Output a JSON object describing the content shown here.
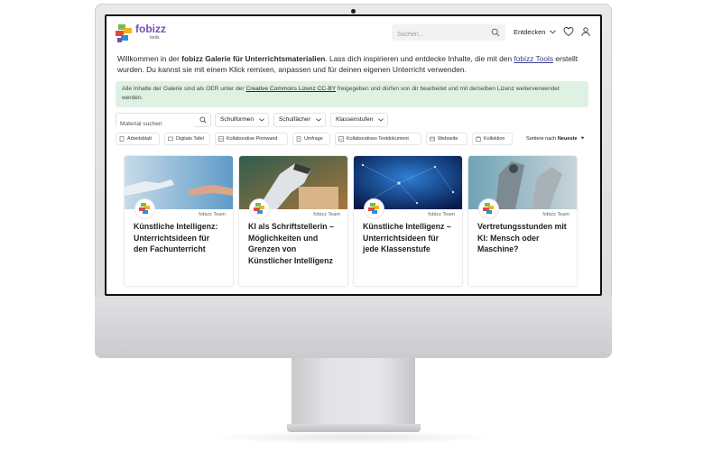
{
  "app": {
    "logo_text": "fobizz",
    "logo_sub": "tools",
    "brand_color": "#7a4fb0"
  },
  "header": {
    "search_placeholder": "Suchen...",
    "explore_label": "Entdecken",
    "icons": [
      "search-icon",
      "chevron-down-icon",
      "heart-icon",
      "user-icon"
    ]
  },
  "intro": {
    "part1": "Willkommen in der ",
    "bold": "fobizz Galerie für Unterrichtsmaterialien",
    "part2": ". Lass dich inspirieren und entdecke Inhalte, die mit den ",
    "link": "fobizz Tools",
    "part3": " erstellt wurden. Du kannst sie mit einem Klick remixen, anpassen und für deinen eigenen Unterricht verwenden."
  },
  "notice": {
    "part1": "Alle Inhalte der Galerie sind als OER unter der ",
    "link": "Creative Commons Lizenz CC-BY",
    "part2": " freigegeben und dürfen von dir bearbeitet und mit derselben Lizenz weiterverwendet werden.",
    "bg_color": "#dff1e3"
  },
  "filters": {
    "search_placeholder": "Material suchen",
    "dropdowns": [
      "Schulformen",
      "Schulfächer",
      "Klassenstufen"
    ]
  },
  "chips": [
    {
      "label": "Arbeitsblatt",
      "icon": "document-icon"
    },
    {
      "label": "Digitale Tafel",
      "icon": "board-icon"
    },
    {
      "label": "Kollaborative Pinnwand",
      "icon": "pinboard-icon"
    },
    {
      "label": "Umfrage",
      "icon": "poll-icon"
    },
    {
      "label": "Kollaboratives Textdokument",
      "icon": "text-document-icon"
    },
    {
      "label": "Webseite",
      "icon": "website-icon"
    },
    {
      "label": "Kollektion",
      "icon": "collection-icon"
    }
  ],
  "sort": {
    "prefix": "Sortiere nach ",
    "value": "Neueste"
  },
  "cards": [
    {
      "author": "fobizz Team",
      "title": "Künstliche Intelligenz: Unterrichtsideen für den Fachunterricht"
    },
    {
      "author": "fobizz Team",
      "title": "KI als Schriftstellerin – Möglichkeiten und Grenzen von Künstlicher Intelligenz"
    },
    {
      "author": "fobizz Team",
      "title": "Künstliche Intelligenz – Unterrichtsideen für jede Klassenstufe"
    },
    {
      "author": "fobizz Team",
      "title": "Vertretungsstunden mit KI: Mensch oder Maschine?"
    }
  ]
}
